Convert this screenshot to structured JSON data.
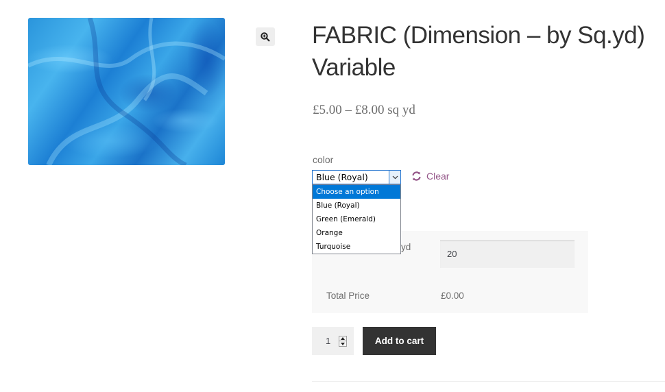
{
  "product": {
    "title": "FABRIC (Dimension – by Sq.yd) Variable",
    "price_range": "£5.00 – £8.00 sq yd",
    "image_alt": "Blue satin fabric",
    "zoom_icon": "magnifier-plus-icon"
  },
  "variation": {
    "label": "color",
    "selected": "Blue (Royal)",
    "clear_label": "Clear",
    "clear_icon": "refresh-icon",
    "options": [
      {
        "label": "Choose an option",
        "highlighted": true
      },
      {
        "label": "Blue (Royal)",
        "highlighted": false
      },
      {
        "label": "Green (Emerald)",
        "highlighted": false
      },
      {
        "label": "Orange",
        "highlighted": false
      },
      {
        "label": "Turquoise",
        "highlighted": false
      }
    ]
  },
  "calculator": {
    "dimension_label_visible": "yd",
    "dimension_value": "20",
    "total_label": "Total Price",
    "total_value": "£0.00"
  },
  "cart": {
    "quantity": "1",
    "add_to_cart_label": "Add to cart",
    "button_color": "#333333"
  },
  "colors": {
    "clear_link": "#96588a",
    "dropdown_highlight": "#0078d7"
  }
}
